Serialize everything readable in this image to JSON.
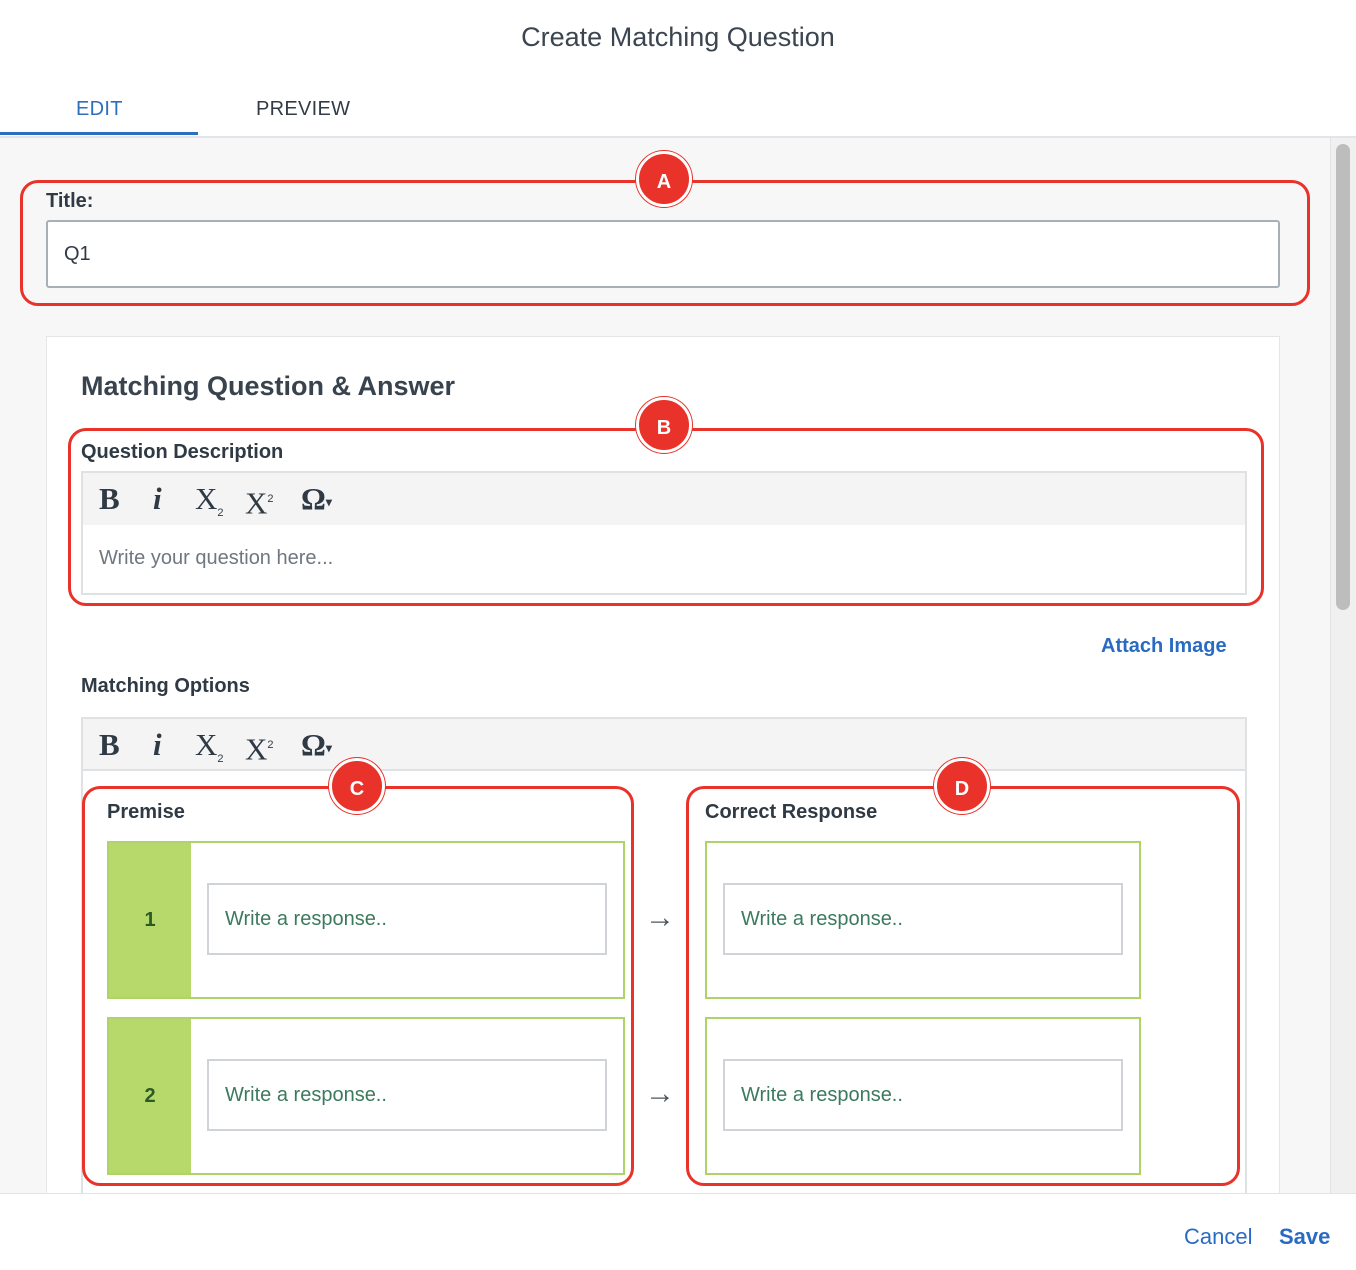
{
  "dialog": {
    "title": "Create Matching Question"
  },
  "tabs": [
    {
      "label": "EDIT",
      "active": true
    },
    {
      "label": "PREVIEW",
      "active": false
    }
  ],
  "title_field": {
    "label": "Title:",
    "value": "Q1"
  },
  "card": {
    "heading": "Matching Question & Answer",
    "question_description": {
      "label": "Question Description",
      "placeholder": "Write your question here..."
    },
    "attach_image": "Attach Image",
    "matching_options": {
      "label": "Matching Options"
    },
    "premise": {
      "label": "Premise",
      "rows": [
        {
          "number": "1",
          "placeholder": "Write a response.."
        },
        {
          "number": "2",
          "placeholder": "Write a response.."
        }
      ]
    },
    "correct_response": {
      "label": "Correct Response",
      "rows": [
        {
          "placeholder": "Write a response.."
        },
        {
          "placeholder": "Write a response.."
        }
      ]
    }
  },
  "toolbar": {
    "bold": "B",
    "italic": "i",
    "subscript_base": "X",
    "subscript_mark": "2",
    "superscript_base": "X",
    "superscript_mark": "2",
    "omega": "Ω",
    "omega_caret": "▾"
  },
  "callouts": {
    "a": "A",
    "b": "B",
    "c": "C",
    "d": "D"
  },
  "arrow_glyph": "→",
  "footer": {
    "cancel": "Cancel",
    "save": "Save"
  },
  "colors": {
    "accent": "#2d6fbd",
    "callout_red": "#e8322a",
    "premise_green": "#b7d96b",
    "row_border_green": "#aed468"
  }
}
